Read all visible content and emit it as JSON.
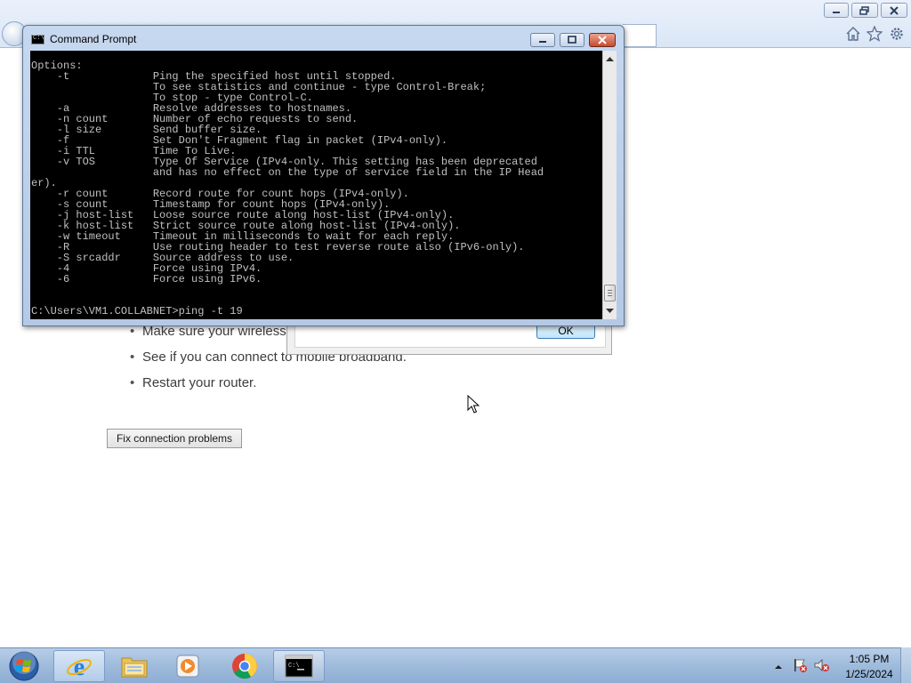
{
  "cmd_window": {
    "title": "Command Prompt",
    "lines": [
      "Options:",
      "    -t             Ping the specified host until stopped.",
      "                   To see statistics and continue - type Control-Break;",
      "                   To stop - type Control-C.",
      "    -a             Resolve addresses to hostnames.",
      "    -n count       Number of echo requests to send.",
      "    -l size        Send buffer size.",
      "    -f             Set Don't Fragment flag in packet (IPv4-only).",
      "    -i TTL         Time To Live.",
      "    -v TOS         Type Of Service (IPv4-only. This setting has been deprecated",
      "                   and has no effect on the type of service field in the IP Head",
      "er).",
      "    -r count       Record route for count hops (IPv4-only).",
      "    -s count       Timestamp for count hops (IPv4-only).",
      "    -j host-list   Loose source route along host-list (IPv4-only).",
      "    -k host-list   Strict source route along host-list (IPv4-only).",
      "    -w timeout     Timeout in milliseconds to wait for each reply.",
      "    -R             Use routing header to test reverse route also (IPv6-only).",
      "    -S srcaddr     Source address to use.",
      "    -4             Force using IPv4.",
      "    -6             Force using IPv6.",
      "",
      "",
      "C:\\Users\\VM1.COLLABNET>ping -t 19"
    ]
  },
  "browser": {
    "tips": [
      "Make sure your wireless",
      "See if you can connect to mobile broadband.",
      "Restart your router."
    ],
    "fix_button": "Fix connection problems",
    "dialog_ok": "OK"
  },
  "taskbar": {
    "apps": [
      "internet-explorer",
      "file-explorer",
      "media-player",
      "chrome",
      "command-prompt"
    ],
    "clock_time": "1:05 PM",
    "clock_date": "1/25/2024"
  }
}
